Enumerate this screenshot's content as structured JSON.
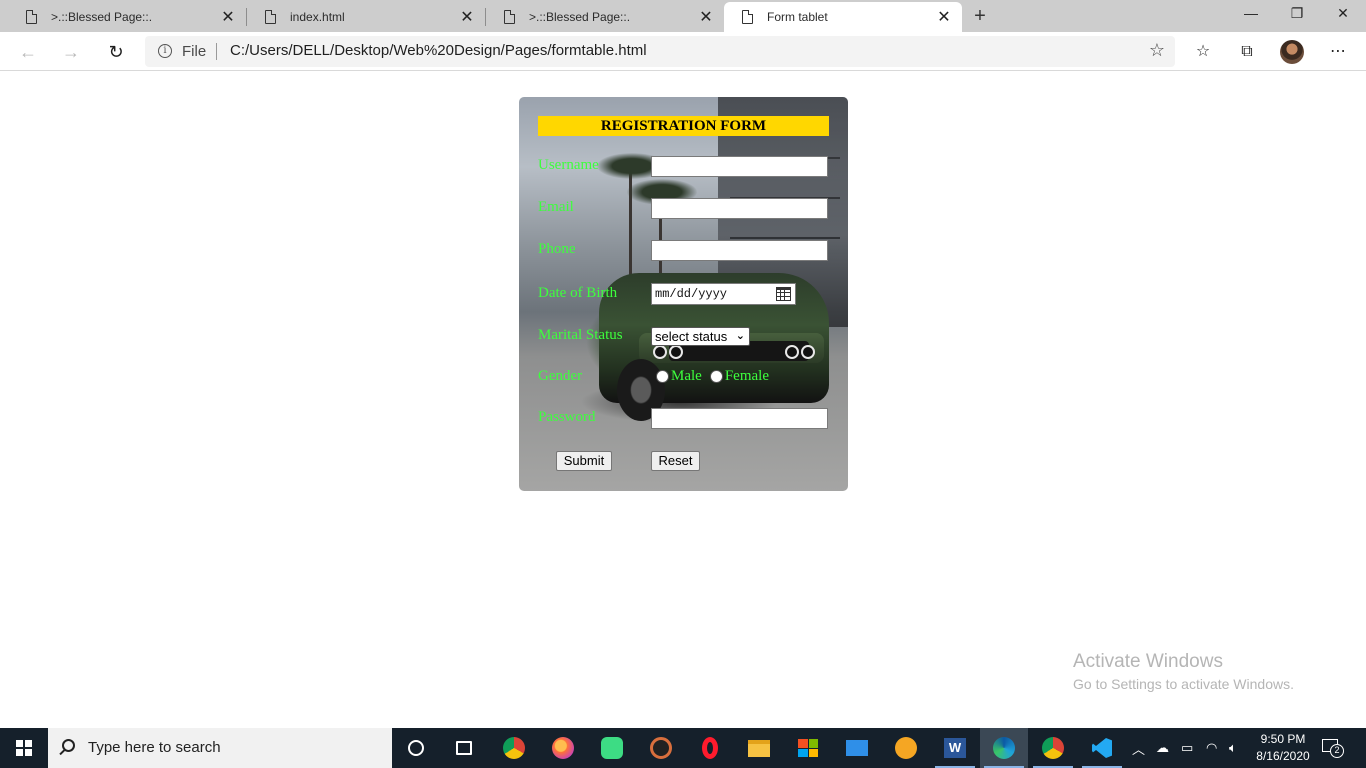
{
  "browser": {
    "tabs": [
      {
        "title": ">.::Blessed Page::.",
        "active": false
      },
      {
        "title": "index.html",
        "active": false
      },
      {
        "title": ">.::Blessed Page::.",
        "active": false
      },
      {
        "title": "Form tablet",
        "active": true
      }
    ],
    "new_tab_glyph": "+",
    "window_controls": {
      "minimize": "—",
      "restore": "❐",
      "close": "✕"
    },
    "address_bar": {
      "scheme_label": "File",
      "url": "C:/Users/DELL/Desktop/Web%20Design/Pages/formtable.html"
    },
    "icons": [
      "back-icon",
      "forward-icon",
      "refresh-icon",
      "info-icon",
      "star-icon",
      "favorites-icon",
      "collections-icon",
      "profile-avatar",
      "more-icon"
    ]
  },
  "form": {
    "title": "REGISTRATION FORM",
    "fields": {
      "username": {
        "label": "Username",
        "value": ""
      },
      "email": {
        "label": "Email",
        "value": ""
      },
      "phone": {
        "label": "Phone",
        "value": ""
      },
      "dob": {
        "label": "Date of Birth",
        "placeholder": "mm/dd/yyyy"
      },
      "marital": {
        "label": "Marital Status",
        "selected": "select status"
      },
      "gender": {
        "label": "Gender",
        "options": [
          "Male",
          "Female"
        ]
      },
      "password": {
        "label": "Password",
        "value": ""
      }
    },
    "submit_label": "Submit",
    "reset_label": "Reset",
    "colors": {
      "title_bg": "#ffd700",
      "label": "#3dff3d"
    }
  },
  "watermark": {
    "title": "Activate Windows",
    "subtitle": "Go to Settings to activate Windows."
  },
  "taskbar": {
    "search_placeholder": "Type here to search",
    "apps": [
      "cortana",
      "task-view",
      "chrome",
      "firefox",
      "android-app",
      "media-player",
      "opera",
      "file-explorer",
      "microsoft-store",
      "mail",
      "brave",
      "word",
      "edge",
      "chrome-profile",
      "vscode"
    ],
    "clock_time": "9:50 PM",
    "clock_date": "8/16/2020",
    "notification_count": "2"
  }
}
